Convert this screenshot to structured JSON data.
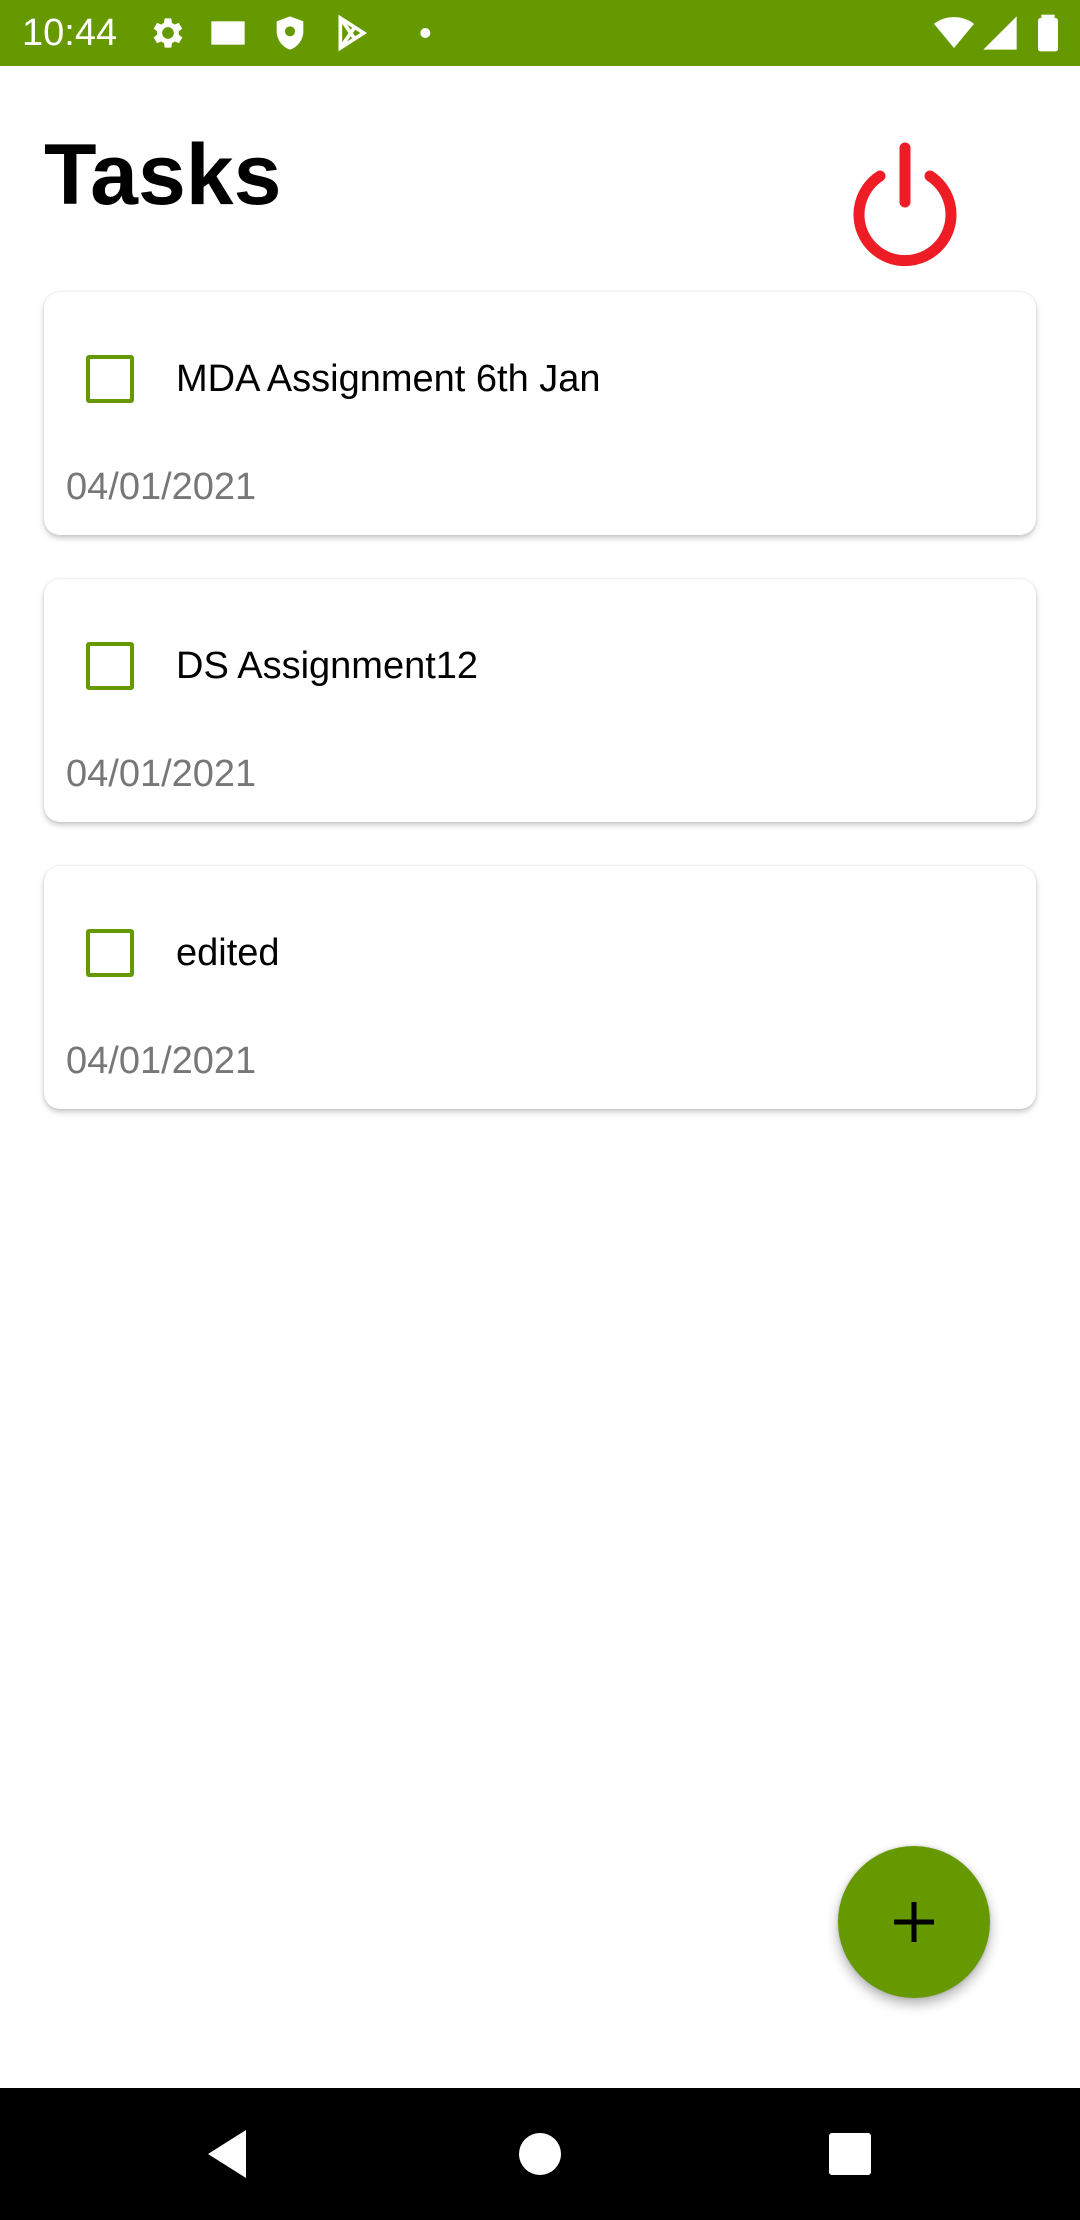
{
  "status_bar": {
    "time": "10:44",
    "left_icons": [
      "gear-icon",
      "card-icon",
      "shield-icon",
      "play-store-icon",
      "dot-icon"
    ],
    "right_icons": [
      "wifi-icon",
      "signal-icon",
      "battery-icon"
    ]
  },
  "header": {
    "title": "Tasks",
    "power_icon": "power-icon",
    "power_color": "#ee1c24"
  },
  "tasks": [
    {
      "title": "MDA Assignment 6th Jan",
      "date": "04/01/2021",
      "checked": false
    },
    {
      "title": "DS Assignment12",
      "date": "04/01/2021",
      "checked": false
    },
    {
      "title": "edited",
      "date": "04/01/2021",
      "checked": false
    }
  ],
  "fab": {
    "icon": "plus-icon"
  },
  "nav_bar": {
    "icons": [
      "back-icon",
      "home-icon",
      "recents-icon"
    ]
  },
  "colors": {
    "accent": "#669900",
    "date_text": "#777777",
    "power": "#ee1c24"
  }
}
